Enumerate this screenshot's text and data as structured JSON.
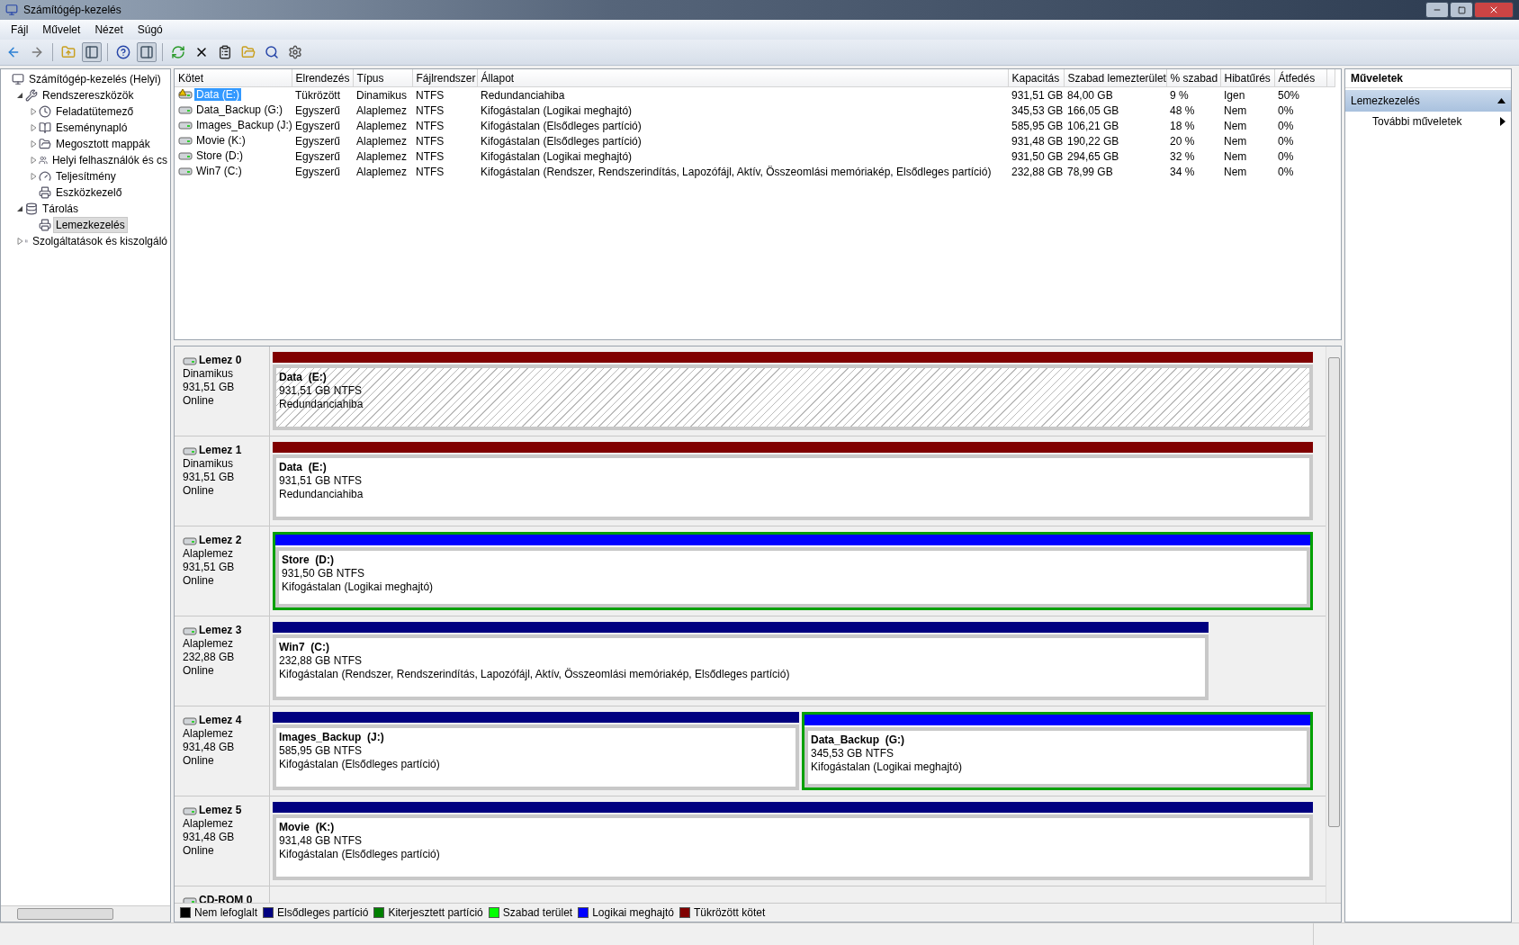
{
  "window": {
    "title": "Számítógép-kezelés"
  },
  "menu": [
    "Fájl",
    "Művelet",
    "Nézet",
    "Súgó"
  ],
  "tree": [
    {
      "label": "Számítógép-kezelés (Helyi)",
      "selected": false,
      "children": [
        {
          "label": "Rendszereszközök",
          "expanded": true,
          "selected": false,
          "children": [
            {
              "label": "Feladatütemező",
              "expanded": false,
              "selected": false
            },
            {
              "label": "Eseménynapló",
              "expanded": false,
              "selected": false
            },
            {
              "label": "Megosztott mappák",
              "expanded": false,
              "selected": false
            },
            {
              "label": "Helyi felhasználók és cs",
              "expanded": false,
              "selected": false
            },
            {
              "label": "Teljesítmény",
              "expanded": false,
              "selected": false
            },
            {
              "label": "Eszközkezelő",
              "selected": false
            }
          ]
        },
        {
          "label": "Tárolás",
          "expanded": true,
          "selected": false,
          "children": [
            {
              "label": "Lemezkezelés",
              "selected": true
            }
          ]
        },
        {
          "label": "Szolgáltatások és kiszolgáló",
          "expanded": false,
          "selected": false
        }
      ]
    }
  ],
  "volumes": {
    "columns": [
      "Kötet",
      "Elrendezés",
      "Típus",
      "Fájlrendszer",
      "Állapot",
      "Kapacitás",
      "Szabad lemezterület",
      "% szabad",
      "Hibatűrés",
      "Átfedés"
    ],
    "rows": [
      {
        "selected": true,
        "warning": true,
        "cells": [
          "Data (E:)",
          "Tükrözött",
          "Dinamikus",
          "NTFS",
          "Redundanciahiba",
          "931,51 GB",
          "84,00 GB",
          "9 %",
          "Igen",
          "50%"
        ]
      },
      {
        "selected": false,
        "warning": false,
        "cells": [
          "Data_Backup (G:)",
          "Egyszerű",
          "Alaplemez",
          "NTFS",
          "Kifogástalan (Logikai meghajtó)",
          "345,53 GB",
          "166,05 GB",
          "48 %",
          "Nem",
          "0%"
        ]
      },
      {
        "selected": false,
        "warning": false,
        "cells": [
          "Images_Backup (J:)",
          "Egyszerű",
          "Alaplemez",
          "NTFS",
          "Kifogástalan (Elsődleges partíció)",
          "585,95 GB",
          "106,21 GB",
          "18 %",
          "Nem",
          "0%"
        ]
      },
      {
        "selected": false,
        "warning": false,
        "cells": [
          "Movie (K:)",
          "Egyszerű",
          "Alaplemez",
          "NTFS",
          "Kifogástalan (Elsődleges partíció)",
          "931,48 GB",
          "190,22 GB",
          "20 %",
          "Nem",
          "0%"
        ]
      },
      {
        "selected": false,
        "warning": false,
        "cells": [
          "Store (D:)",
          "Egyszerű",
          "Alaplemez",
          "NTFS",
          "Kifogástalan (Logikai meghajtó)",
          "931,50 GB",
          "294,65 GB",
          "32 %",
          "Nem",
          "0%"
        ]
      },
      {
        "selected": false,
        "warning": false,
        "cells": [
          "Win7 (C:)",
          "Egyszerű",
          "Alaplemez",
          "NTFS",
          "Kifogástalan (Rendszer, Rendszerindítás, Lapozófájl, Aktív, Összeomlási memóriakép, Elsődleges partíció)",
          "232,88 GB",
          "78,99 GB",
          "34 %",
          "Nem",
          "0%"
        ]
      }
    ]
  },
  "disks": [
    {
      "name": "Lemez 0",
      "type": "Dinamikus",
      "size": "931,51 GB",
      "status": "Online",
      "partitions": [
        {
          "kind": "mirror",
          "selected": true,
          "name": "Data  (E:)",
          "size": "931,51 GB NTFS",
          "status": "Redundanciahiba"
        }
      ]
    },
    {
      "name": "Lemez 1",
      "type": "Dinamikus",
      "size": "931,51 GB",
      "status": "Online",
      "partitions": [
        {
          "kind": "mirror",
          "selected": false,
          "name": "Data  (E:)",
          "size": "931,51 GB NTFS",
          "status": "Redundanciahiba"
        }
      ]
    },
    {
      "name": "Lemez 2",
      "type": "Alaplemez",
      "size": "931,51 GB",
      "status": "Online",
      "partitions": [
        {
          "kind": "logical",
          "selected": false,
          "name": "Store  (D:)",
          "size": "931,50 GB NTFS",
          "status": "Kifogástalan (Logikai meghajtó)"
        }
      ]
    },
    {
      "name": "Lemez 3",
      "type": "Alaplemez",
      "size": "232,88 GB",
      "status": "Online",
      "partitions": [
        {
          "kind": "primary",
          "selected": false,
          "name": "Win7  (C:)",
          "size": "232,88 GB NTFS",
          "status": "Kifogástalan (Rendszer, Rendszerindítás, Lapozófájl, Aktív, Összeomlási memóriakép, Elsődleges partíció)"
        }
      ]
    },
    {
      "name": "Lemez 4",
      "type": "Alaplemez",
      "size": "931,48 GB",
      "status": "Online",
      "partitions": [
        {
          "kind": "primary",
          "selected": false,
          "name": "Images_Backup  (J:)",
          "size": "585,95 GB NTFS",
          "status": "Kifogástalan (Elsődleges partíció)"
        },
        {
          "kind": "logical",
          "selected": false,
          "name": "Data_Backup  (G:)",
          "size": "345,53 GB NTFS",
          "status": "Kifogástalan (Logikai meghajtó)"
        }
      ]
    },
    {
      "name": "Lemez 5",
      "type": "Alaplemez",
      "size": "931,48 GB",
      "status": "Online",
      "partitions": [
        {
          "kind": "primary",
          "selected": false,
          "name": "Movie  (K:)",
          "size": "931,48 GB NTFS",
          "status": "Kifogástalan (Elsődleges partíció)"
        }
      ]
    }
  ],
  "cdrom": {
    "name": "CD-ROM 0"
  },
  "legend": [
    {
      "label": "Nem lefoglalt",
      "color": "#000000"
    },
    {
      "label": "Elsődleges partíció",
      "color": "#000080"
    },
    {
      "label": "Kiterjesztett partíció",
      "color": "#008000"
    },
    {
      "label": "Szabad terület",
      "color": "#00ff00"
    },
    {
      "label": "Logikai meghajtó",
      "color": "#0000ff"
    },
    {
      "label": "Tükrözött kötet",
      "color": "#800000"
    }
  ],
  "actions": {
    "title": "Műveletek",
    "sections": [
      {
        "label": "Lemezkezelés",
        "expanded": true,
        "items": [
          "További műveletek"
        ]
      }
    ]
  }
}
